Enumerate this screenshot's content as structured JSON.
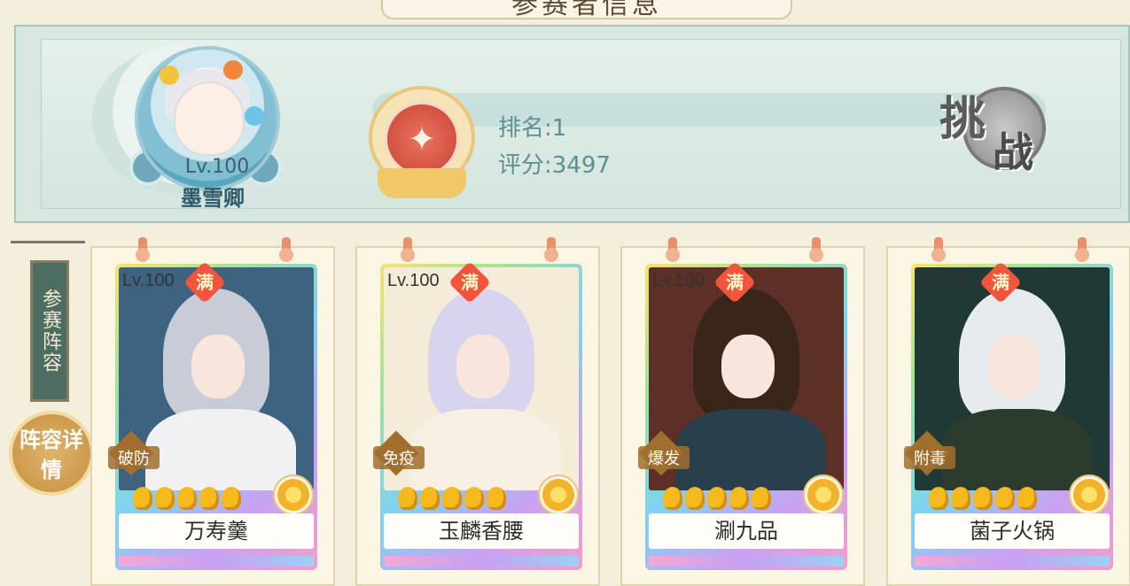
{
  "header": {
    "title": "参赛者信息"
  },
  "player": {
    "level": "Lv.100",
    "name": "墨雪卿",
    "rank": "排名:1",
    "score": "评分:3497"
  },
  "challenge_button": {
    "char1": "挑",
    "char2": "战"
  },
  "sidebar": {
    "lineup_label": "参赛阵容",
    "detail_button": "阵容详情"
  },
  "cards": [
    {
      "level": "Lv.100",
      "full": "满",
      "skill": "破防",
      "name": "万寿羹",
      "stars": 5,
      "hair": "#c7ccd6",
      "body": "#f1f1f3",
      "bg": "#3e6380"
    },
    {
      "level": "Lv.100",
      "full": "满",
      "skill": "免疫",
      "name": "玉麟香腰",
      "stars": 5,
      "hair": "#d9d4ee",
      "body": "#f6efe2",
      "bg": "#f4ebd8"
    },
    {
      "level": "Lv.100",
      "full": "满",
      "skill": "爆发",
      "name": "涮九品",
      "stars": 5,
      "hair": "#3a2519",
      "body": "#2a3f4c",
      "bg": "#5b3026"
    },
    {
      "level": "Lv.100",
      "full": "满",
      "skill": "附毒",
      "name": "菌子火锅",
      "stars": 5,
      "hair": "#e6ecee",
      "body": "#2b3b2e",
      "bg": "#1f3a36"
    }
  ]
}
